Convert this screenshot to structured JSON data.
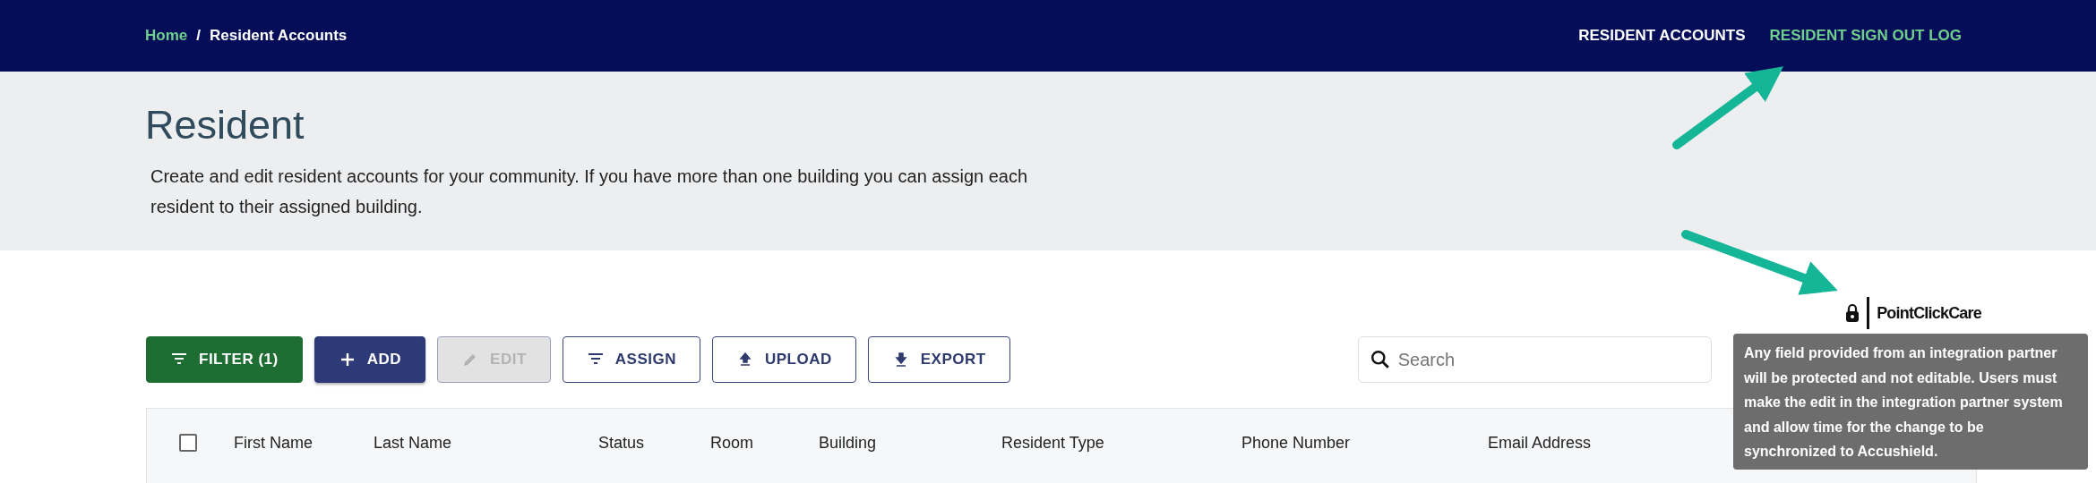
{
  "breadcrumb": [
    {
      "label": "Home",
      "kind": "link"
    },
    {
      "label": "/",
      "kind": "separator"
    },
    {
      "label": "Resident Accounts",
      "kind": "current"
    }
  ],
  "nav_links": [
    {
      "label": "RESIDENT ACCOUNTS",
      "selected": false
    },
    {
      "label": "RESIDENT SIGN OUT LOG",
      "selected": true
    }
  ],
  "page": {
    "title": "Resident",
    "description": "Create and edit resident accounts for your community. If you have more than one building you can assign each resident to their assigned building."
  },
  "integration": {
    "logo_text": "PointClickCare",
    "tooltip": "Any field provided from an integration partner will be protected and not editable. Users must make the edit in the integration partner system and allow time for the change to be synchronized to Accushield."
  },
  "toolbar": {
    "buttons": [
      {
        "label": "FILTER (1)",
        "kind": "success",
        "disabled": false
      },
      {
        "label": "ADD",
        "kind": "primary",
        "disabled": false
      },
      {
        "label": "EDIT",
        "kind": "outlined",
        "disabled": true
      },
      {
        "label": "ASSIGN",
        "kind": "outlined",
        "disabled": false
      },
      {
        "label": "UPLOAD",
        "kind": "outlined",
        "disabled": false
      },
      {
        "label": "EXPORT",
        "kind": "outlined",
        "disabled": false
      }
    ],
    "search": {
      "placeholder": "Search"
    }
  },
  "table": {
    "select_all": {
      "checked": false
    },
    "columns": [
      "First Name",
      "Last Name",
      "Status",
      "Room",
      "Building",
      "Resident Type",
      "Phone Number",
      "Email Address"
    ]
  }
}
